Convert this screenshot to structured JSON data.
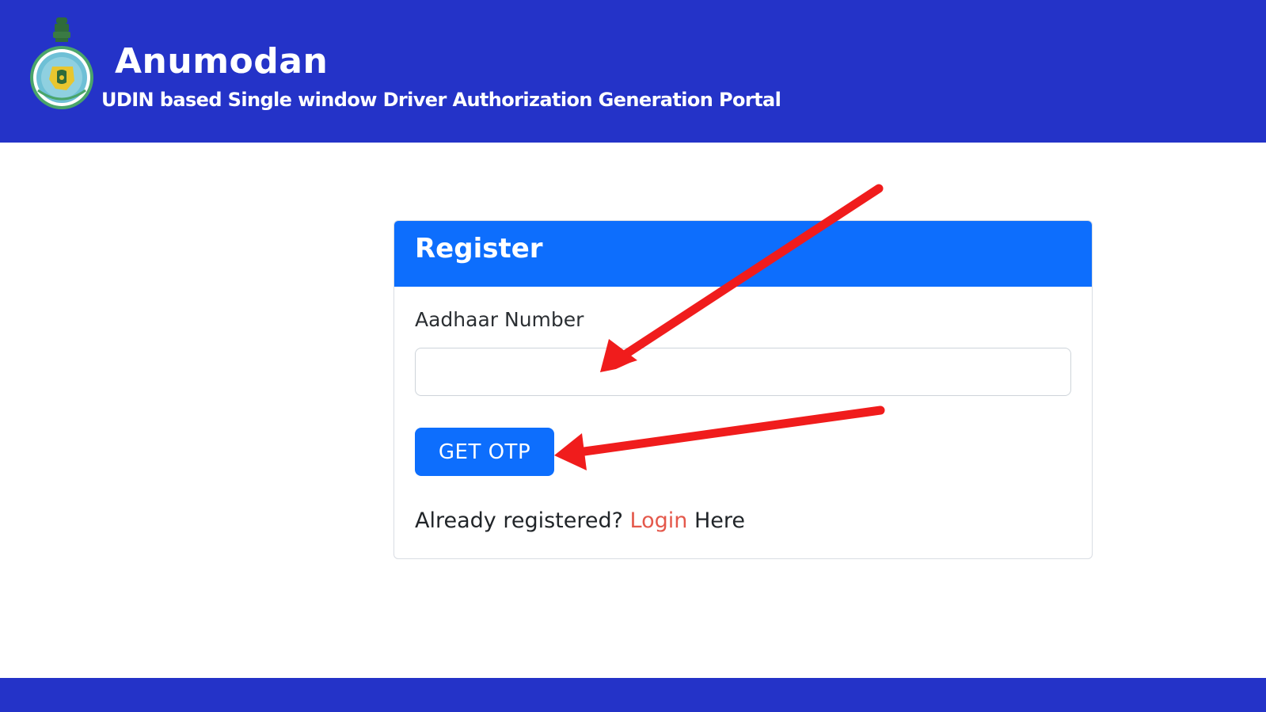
{
  "header": {
    "title": "Anumodan",
    "subtitle": "UDIN based Single window Driver Authorization Generation Portal",
    "emblem_icon": "west-bengal-emblem-icon"
  },
  "register_card": {
    "title": "Register",
    "aadhaar_label": "Aadhaar Number",
    "aadhaar_value": "",
    "get_otp_label": "GET OTP",
    "already_registered_text": "Already registered?",
    "login_link_text": "Login",
    "login_suffix_text": "Here"
  },
  "annotations": {
    "arrow_color": "#f01c1c",
    "arrow_count": 2
  },
  "colors": {
    "header_bg": "#2433c8",
    "card_header_bg": "#0d6efd",
    "button_bg": "#0d6efd",
    "link_color": "#e4584b"
  }
}
